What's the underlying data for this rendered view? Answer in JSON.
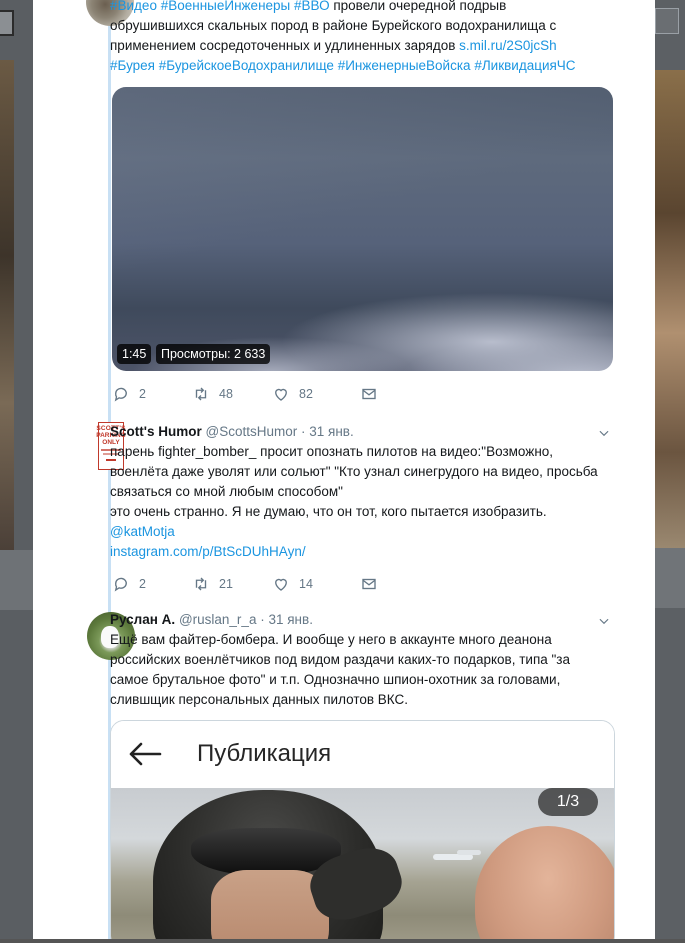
{
  "thread": [
    {
      "text_lines": [
        [
          {
            "t": "#Видео",
            "k": "hash"
          },
          {
            "t": " ",
            "k": "plain"
          },
          {
            "t": "#ВоенныеИнженеры",
            "k": "hash"
          },
          {
            "t": " ",
            "k": "plain"
          },
          {
            "t": "#ВВО",
            "k": "hash"
          },
          {
            "t": " провели очередной подрыв",
            "k": "plain"
          }
        ],
        [
          {
            "t": "обрушившихся скальных пород в районе Бурейского водохранилища с",
            "k": "plain"
          }
        ],
        [
          {
            "t": "применением сосредоточенных и удлиненных зарядов ",
            "k": "plain"
          },
          {
            "t": "s.mil.ru/2S0jcSh",
            "k": "link"
          }
        ],
        [
          {
            "t": "#Бурея",
            "k": "hash"
          },
          {
            "t": " ",
            "k": "plain"
          },
          {
            "t": "#БурейскоеВодохранилище",
            "k": "hash"
          },
          {
            "t": " ",
            "k": "plain"
          },
          {
            "t": "#ИнженерныеВойска",
            "k": "hash"
          },
          {
            "t": " ",
            "k": "plain"
          },
          {
            "t": "#ЛиквидацияЧС",
            "k": "hash"
          }
        ]
      ],
      "video": {
        "duration": "1:45",
        "views": "Просмотры: 2 633"
      },
      "actions": {
        "replies": "2",
        "retweets": "48",
        "likes": "82"
      }
    },
    {
      "name": "Scott's Humor",
      "handle": "@ScottsHumor",
      "separator": "·",
      "date": "31 янв.",
      "avatar_sign": [
        "SCOTT'S",
        "PARKING",
        "ONLY"
      ],
      "text_lines": [
        "парень fighter_bomber_  просит опознать пилотов на видео:\"Возможно,",
        "военлёта даже уволят или сольют\" \"Кто узнал синегрудого на видео, просьба",
        "связаться со мной любым способом\"",
        "это очень странно. Я не думаю, что он тот, кого пытается изобразить."
      ],
      "mention": "@katMotja",
      "link": "instagram.com/p/BtScDUhHAyn/",
      "actions": {
        "replies": "2",
        "retweets": "21",
        "likes": "14"
      }
    },
    {
      "name": "Руслан А.",
      "handle": "@ruslan_r_a",
      "separator": "·",
      "date": "31 янв.",
      "text_lines": [
        "Ещё вам файтер-бомбера. И вообще у него в аккаунте много деанона",
        "российских военлётчиков под видом раздачи каких-то подарков, типа \"за",
        "самое брутальное фото\" и т.п. Однозначно шпион-охотник за головами,",
        "слившщик персональных данных пилотов ВКС."
      ],
      "quote": {
        "title": "Публикация",
        "counter": "1/3"
      }
    }
  ],
  "colors": {
    "link": "#1b95e0",
    "muted": "#657786",
    "thread_line": "#c8e0f4"
  }
}
